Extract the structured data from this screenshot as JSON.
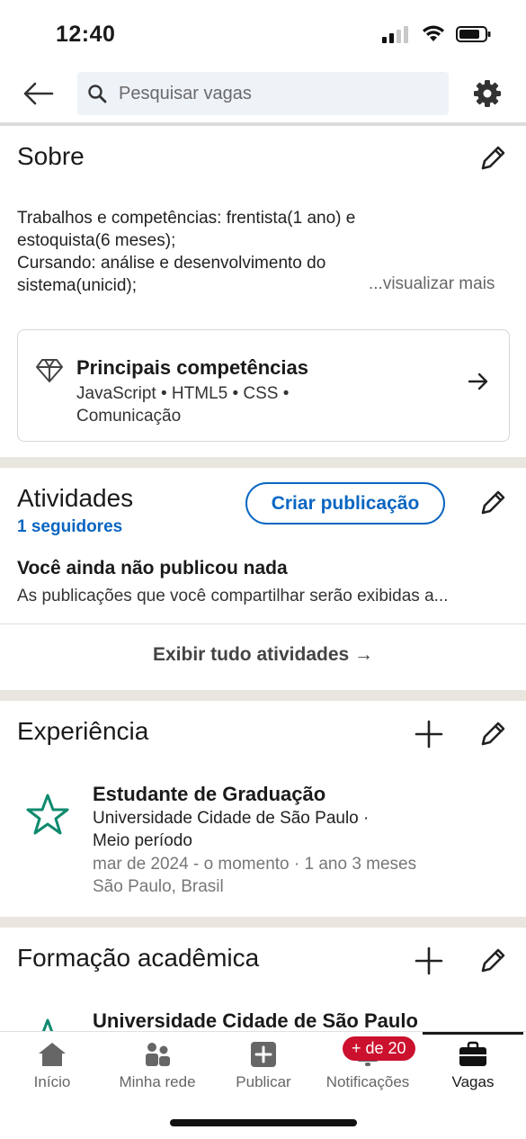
{
  "status_bar": {
    "time": "12:40"
  },
  "search": {
    "placeholder": "Pesquisar vagas"
  },
  "about": {
    "title": "Sobre",
    "lines": [
      "Trabalhos e competências: frentista(1 ano) e",
      "estoquista(6 meses);",
      "Cursando: análise e desenvolvimento do",
      "sistema(unicid);"
    ],
    "see_more": "...visualizar mais"
  },
  "skills": {
    "title": "Principais competências",
    "line1": "JavaScript • HTML5 • CSS •",
    "line2": "Comunicação"
  },
  "activities": {
    "title": "Atividades",
    "followers": "1 seguidores",
    "create_post": "Criar publicação",
    "no_posts_title": "Você ainda não publicou nada",
    "no_posts_sub": "As publicações que você compartilhar serão exibidas a...",
    "show_all": "Exibir tudo atividades →"
  },
  "experience": {
    "title": "Experiência",
    "items": [
      {
        "role": "Estudante de Graduação",
        "company": "Universidade Cidade de São Paulo ·",
        "type": "Meio período",
        "dates": "mar de 2024 - o momento · 1 ano 3 meses",
        "location": "São Paulo, Brasil"
      }
    ]
  },
  "education": {
    "title": "Formação acadêmica",
    "items": [
      {
        "school": "Universidade Cidade de São Paulo"
      }
    ]
  },
  "bottom_nav": {
    "items": [
      {
        "label": "Início",
        "icon": "home-icon"
      },
      {
        "label": "Minha rede",
        "icon": "network-icon"
      },
      {
        "label": "Publicar",
        "icon": "post-icon"
      },
      {
        "label": "Notificações",
        "icon": "bell-icon"
      },
      {
        "label": "Vagas",
        "icon": "briefcase-icon"
      }
    ],
    "notification_badge": "+ de 20",
    "active": "Vagas"
  },
  "colors": {
    "accent": "#0a66c2",
    "badge": "#cb112d",
    "section_gap": "#e9e6df",
    "logo_green": "#0e8a6e"
  }
}
